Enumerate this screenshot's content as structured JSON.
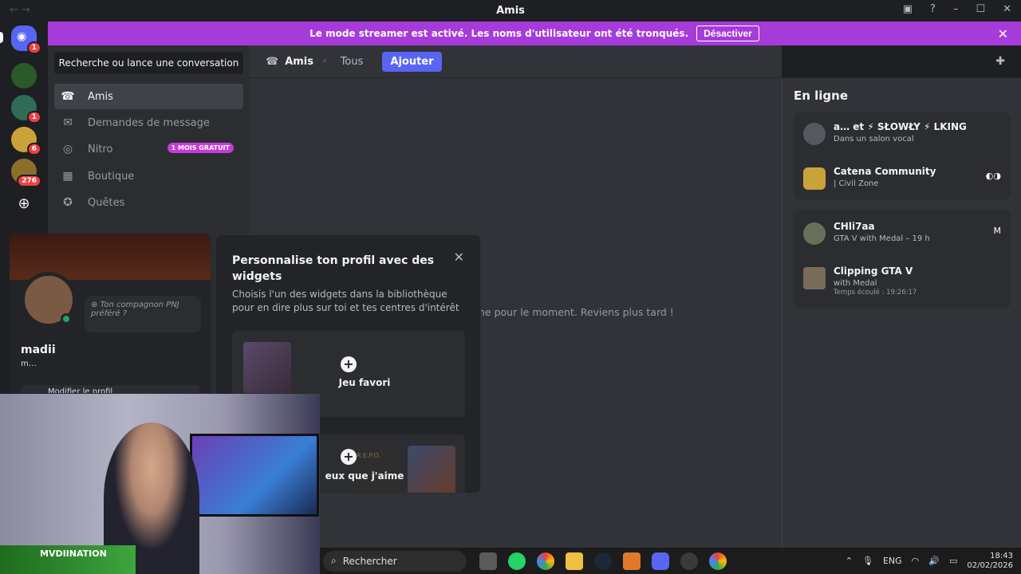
{
  "window": {
    "title": "Amis",
    "help_icon": "question-icon",
    "inbox_icon": "inbox-icon"
  },
  "banner": {
    "message": "Le mode streamer est activé. Les noms d'utilisateur ont été tronqués.",
    "button": "Désactiver",
    "close": "✕"
  },
  "servers": [
    {
      "name": "discord-home",
      "badge": "1",
      "color": "#5865f2"
    },
    {
      "name": "server-mvdiination",
      "badge": "",
      "color": "#2a5a2a"
    },
    {
      "name": "server-2",
      "badge": "1",
      "color": "#2f6b55"
    },
    {
      "name": "server-3",
      "badge": "6",
      "color": "#c9a23a"
    },
    {
      "name": "server-4",
      "badge": "276",
      "color": "#8a6f2a"
    }
  ],
  "dm_panel": {
    "search_label": "Recherche ou lance une conversation",
    "items": [
      {
        "label": "Amis",
        "icon": "friends-icon"
      },
      {
        "label": "Demandes de message",
        "icon": "mail-icon"
      },
      {
        "label": "Nitro",
        "icon": "nitro-icon",
        "badge": "1 MOIS GRATUIT"
      },
      {
        "label": "Boutique",
        "icon": "shop-icon"
      },
      {
        "label": "Quêtes",
        "icon": "quests-icon"
      }
    ]
  },
  "topbar": {
    "title": "Amis",
    "tab_all": "Tous",
    "add_button": "Ajouter"
  },
  "main": {
    "empty_message": "ne pour le moment. Reviens plus tard !"
  },
  "online": {
    "heading": "En ligne",
    "group1": [
      {
        "name": "a… et ⚡ SŁOWŁY ⚡ LKING",
        "sub": "Dans un salon vocal",
        "sub2": ""
      },
      {
        "name": "Catena Community",
        "sub": "| Civil Zone",
        "sub2": ""
      }
    ],
    "group2": [
      {
        "name": "CHli7aa",
        "sub": "GTA V with Medal – 19 h",
        "sub2": ""
      },
      {
        "name": "Clipping GTA V",
        "sub": "with Medal",
        "sub2": "Temps écoulé : 19:26:17"
      }
    ]
  },
  "profile": {
    "npc_placeholder": "Ton compagnon PNJ préféré ?",
    "name": "madii",
    "handle": "m…",
    "edit_button": "Modifier le profil"
  },
  "widget": {
    "title": "Personnalise ton profil avec des widgets",
    "description": "Choisis l'un des widgets dans la bibliothèque pour en dire plus sur toi et tes centres d'intérêt",
    "card1_label": "Jeu favori",
    "card2_label": "eux que j'aime",
    "card2_tag": "R.E.P.O."
  },
  "webcam": {
    "overlay_text": "MVDIINATION"
  },
  "taskbar": {
    "search": "Rechercher",
    "lang": "ENG",
    "time": "18:43",
    "date": "02/02/2026"
  }
}
